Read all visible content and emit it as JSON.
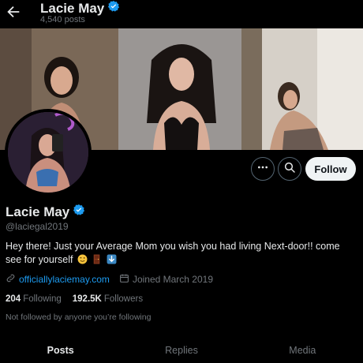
{
  "header": {
    "name": "Lacie May",
    "post_count": "4,540 posts",
    "back_icon": "arrow-left-icon",
    "verified_color": "#1d9bf0"
  },
  "profile": {
    "display_name": "Lacie May",
    "handle": "@laciegal2019",
    "bio": "Hey there! Just your Average Mom you wish you had living Next-door!! come see for yourself",
    "bio_emojis": [
      "winking-face-icon",
      "door-icon",
      "down-arrow-icon"
    ],
    "website": "officiallylaciemay.com",
    "joined": "Joined March 2019",
    "following_count": "204",
    "following_label": "Following",
    "followers_count": "192.5K",
    "followers_label": "Followers",
    "follow_note": "Not followed by anyone you’re following"
  },
  "actions": {
    "more_icon": "more-icon",
    "search_icon": "search-icon",
    "follow_label": "Follow"
  },
  "tabs": [
    {
      "label": "Posts",
      "active": true
    },
    {
      "label": "Replies",
      "active": false
    },
    {
      "label": "Media",
      "active": false
    }
  ],
  "colors": {
    "background": "#000000",
    "text_primary": "#e7e9ea",
    "text_secondary": "#71767b",
    "accent": "#1d9bf0",
    "follow_button": "#eff3f4"
  }
}
